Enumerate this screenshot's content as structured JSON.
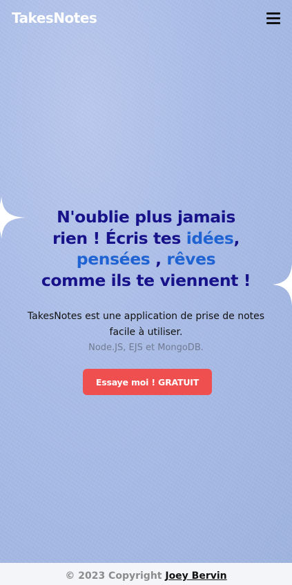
{
  "header": {
    "brand": "TakesNotes",
    "menu_icon": "hamburger-menu-icon"
  },
  "hero": {
    "headline": {
      "line1": "N'oublie plus jamais",
      "line2_start": "rien ! Écris tes ",
      "ideas": "idées",
      "line2_end": ",",
      "thoughts": "pensées",
      "line3_sep": " , ",
      "dreams": "rêves",
      "line4": "comme ils te viennent !"
    },
    "description": "TakesNotes est une application de prise de notes facile à utiliser.",
    "tech_stack": "Node.JS, EJS et MongoDB.",
    "cta_label": "Essaye moi ! GRATUIT"
  },
  "footer": {
    "copyright": "© 2023 Copyright ",
    "author": "Joey Bervin"
  },
  "colors": {
    "headline": "#17118a",
    "accent": "#1f63d3",
    "cta_bg": "#f04f4f",
    "hero_bg": "#a9bce6",
    "footer_bg": "#f4f5f8"
  },
  "icons": {
    "left_decor": "sparkle-icon",
    "right_decor": "sparkle-icon"
  }
}
